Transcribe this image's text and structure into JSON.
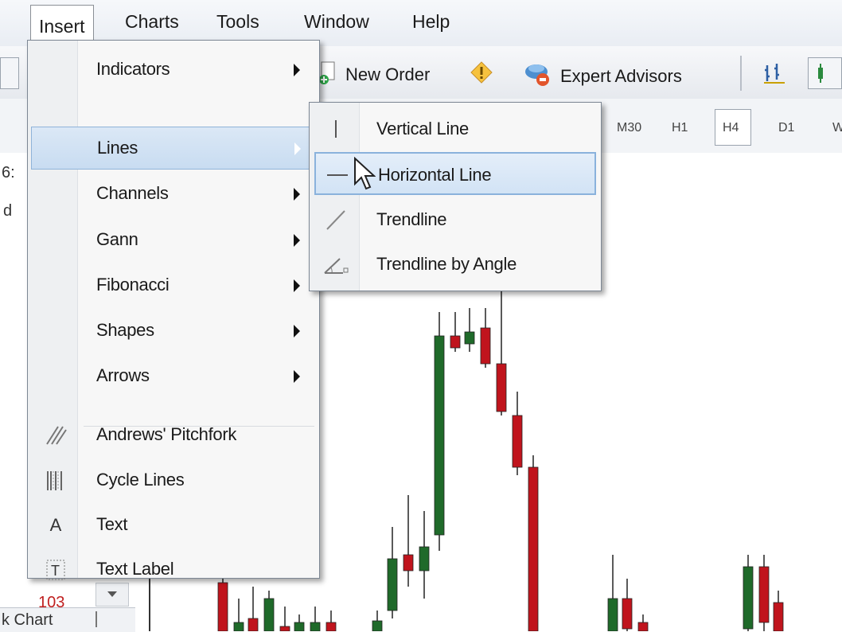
{
  "menubar": {
    "items": [
      {
        "label": "Insert"
      },
      {
        "label": "Charts"
      },
      {
        "label": "Tools"
      },
      {
        "label": "Window"
      },
      {
        "label": "Help"
      }
    ]
  },
  "toolbar": {
    "new_order_label": "New Order",
    "expert_advisors_label": "Expert Advisors"
  },
  "timeframes": [
    "M30",
    "H1",
    "H4",
    "D1",
    "W"
  ],
  "left_panel": {
    "axis_value": "103",
    "tab_label": "k Chart",
    "left_edge_fragments": [
      "6:",
      "d"
    ]
  },
  "insert_menu": {
    "items": [
      {
        "label": "Indicators",
        "submenu": true,
        "icon": ""
      },
      {
        "label": "Lines",
        "submenu": true,
        "highlighted": true,
        "icon": ""
      },
      {
        "label": "Channels",
        "submenu": true,
        "icon": ""
      },
      {
        "label": "Gann",
        "submenu": true,
        "icon": ""
      },
      {
        "label": "Fibonacci",
        "submenu": true,
        "icon": ""
      },
      {
        "label": "Shapes",
        "submenu": true,
        "icon": ""
      },
      {
        "label": "Arrows",
        "submenu": true,
        "icon": ""
      },
      {
        "label": "Andrews' Pitchfork",
        "submenu": false,
        "icon": "pitchfork-icon"
      },
      {
        "label": "Cycle Lines",
        "submenu": false,
        "icon": "cycle-lines-icon"
      },
      {
        "label": "Text",
        "submenu": false,
        "icon": "text-icon"
      },
      {
        "label": "Text Label",
        "submenu": false,
        "icon": "text-label-icon"
      }
    ]
  },
  "lines_submenu": {
    "items": [
      {
        "label": "Vertical Line",
        "icon": "vertical-line-icon"
      },
      {
        "label": "Horizontal Line",
        "icon": "horizontal-line-icon",
        "highlighted": true
      },
      {
        "label": "Trendline",
        "icon": "trendline-icon"
      },
      {
        "label": "Trendline by Angle",
        "icon": "trendline-angle-icon"
      }
    ]
  },
  "colors": {
    "bull_candle": "#1f6a2a",
    "bear_candle": "#c0141d",
    "menu_highlight": "#c8dcf1"
  }
}
